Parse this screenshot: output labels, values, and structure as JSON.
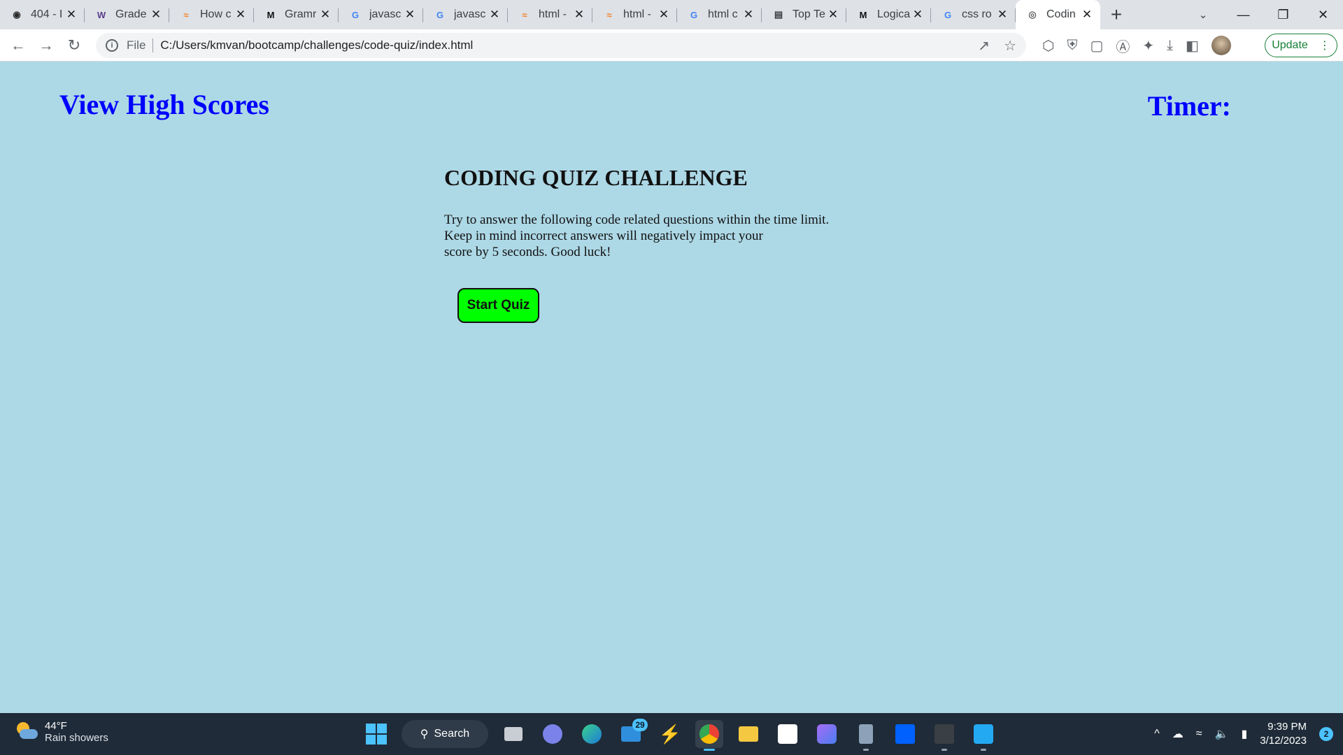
{
  "browser": {
    "tabs": [
      {
        "label": "404 - I",
        "icon": "openai-icon",
        "color": "#2b2b2b"
      },
      {
        "label": "Grade",
        "icon": "w-icon",
        "color": "#5a3e8c"
      },
      {
        "label": "How c",
        "icon": "stackoverflow-icon",
        "color": "#f48024"
      },
      {
        "label": "Gramr",
        "icon": "m-icon",
        "color": "#111111"
      },
      {
        "label": "javasc",
        "icon": "google-icon",
        "color": "#4285f4"
      },
      {
        "label": "javasc",
        "icon": "google-icon",
        "color": "#4285f4"
      },
      {
        "label": "html -",
        "icon": "stackoverflow-icon",
        "color": "#f48024"
      },
      {
        "label": "html -",
        "icon": "stackoverflow-icon",
        "color": "#f48024"
      },
      {
        "label": "html c",
        "icon": "google-icon",
        "color": "#4285f4"
      },
      {
        "label": "Top Te",
        "icon": "reader-icon",
        "color": "#3c4043"
      },
      {
        "label": "Logica",
        "icon": "m-icon",
        "color": "#111111"
      },
      {
        "label": "css ro",
        "icon": "google-icon",
        "color": "#4285f4"
      },
      {
        "label": "Codin",
        "icon": "globe-icon",
        "color": "#5f6368",
        "active": true
      }
    ],
    "address": {
      "scheme": "File",
      "url": "C:/Users/kmvan/bootcamp/challenges/code-quiz/index.html"
    },
    "update_label": "Update"
  },
  "page": {
    "high_scores_link": "View High Scores",
    "timer_label": "Timer:",
    "heading": "CODING QUIZ CHALLENGE",
    "intro_lines": [
      "Try to answer the following code related questions within the time limit.",
      "Keep in mind incorrect answers will negatively impact your",
      "score by 5 seconds. Good luck!"
    ],
    "start_button": "Start Quiz",
    "colors": {
      "background": "#add8e6",
      "link": "#0000ff",
      "button": "#00ff00"
    }
  },
  "taskbar": {
    "weather": {
      "temp": "44°F",
      "condition": "Rain showers"
    },
    "search_label": "Search",
    "mail_badge": "29",
    "clock": {
      "time": "9:39 PM",
      "date": "3/12/2023"
    },
    "notifications": "2"
  }
}
